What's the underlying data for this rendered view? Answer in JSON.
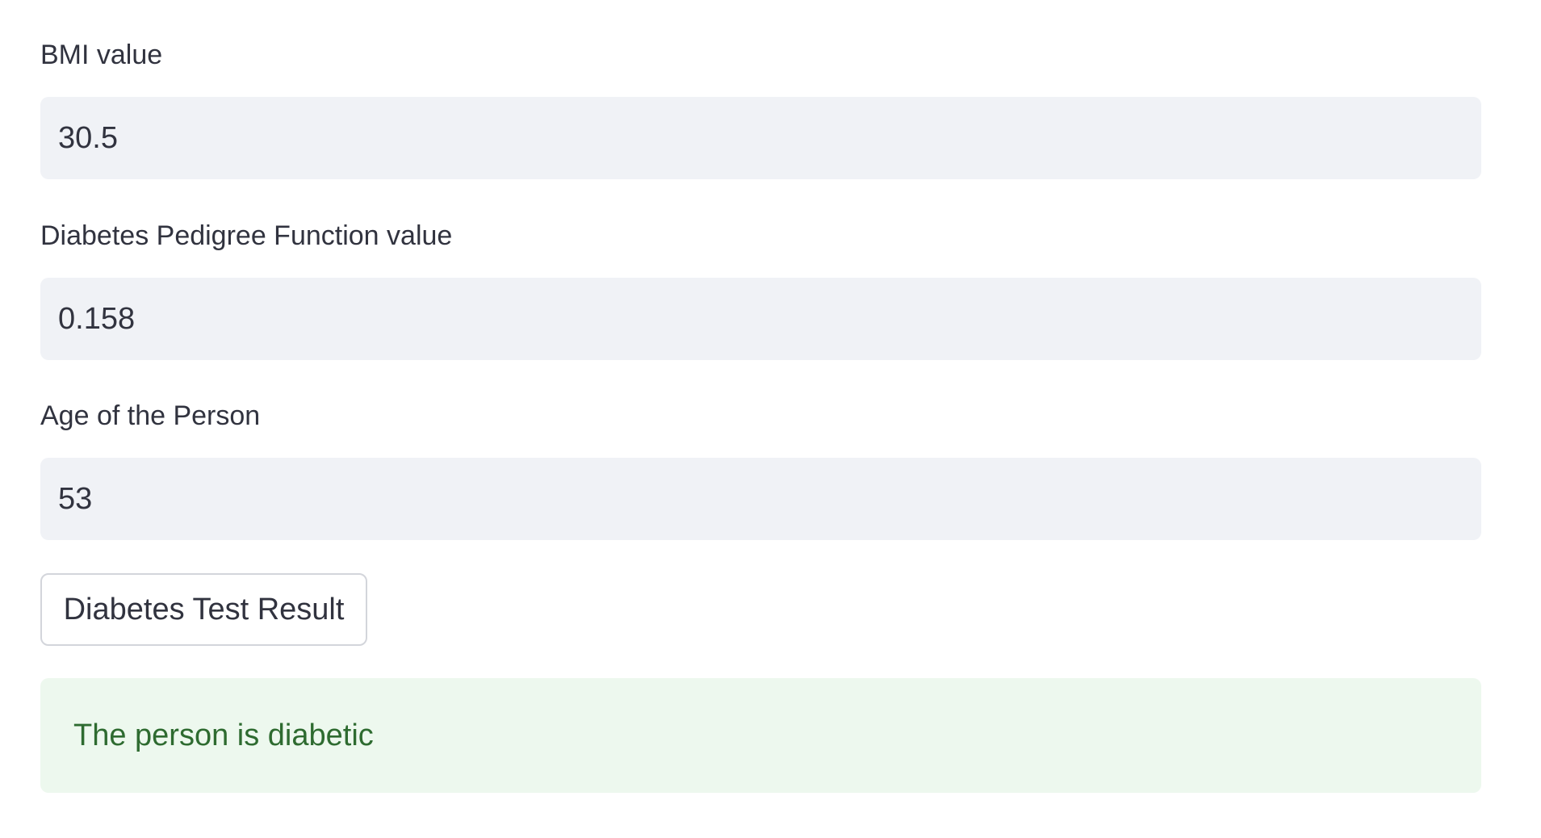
{
  "fields": [
    {
      "label": "BMI value",
      "value": "30.5"
    },
    {
      "label": "Diabetes Pedigree Function value",
      "value": "0.158"
    },
    {
      "label": "Age of the Person",
      "value": "53"
    }
  ],
  "button": {
    "label": "Diabetes Test Result"
  },
  "result": {
    "message": "The person is diabetic",
    "status": "success"
  },
  "colors": {
    "input_background": "#f0f2f6",
    "text": "#31333f",
    "success_background": "#edf8ee",
    "success_text": "#2e6b30"
  }
}
